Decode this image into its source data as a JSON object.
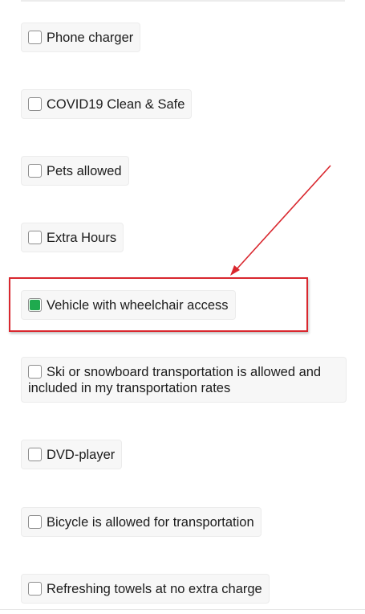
{
  "options": [
    {
      "label": "Phone charger",
      "checked": false
    },
    {
      "label": "COVID19 Clean & Safe",
      "checked": false
    },
    {
      "label": "Pets allowed",
      "checked": false
    },
    {
      "label": "Extra Hours",
      "checked": false
    },
    {
      "label": "Vehicle with wheelchair access",
      "checked": true
    },
    {
      "label": "Ski or snowboard transportation is allowed and included in my transportation rates",
      "checked": false
    },
    {
      "label": "DVD-player",
      "checked": false
    },
    {
      "label": "Bicycle is allowed for transportation",
      "checked": false
    },
    {
      "label": "Refreshing towels at no extra charge",
      "checked": false
    }
  ],
  "colors": {
    "checked_fill": "#1faa4e",
    "annotation_red": "#d9272e"
  },
  "annotation": {
    "arrow_icon": "arrow-icon",
    "highlight_target": "Vehicle with wheelchair access"
  }
}
